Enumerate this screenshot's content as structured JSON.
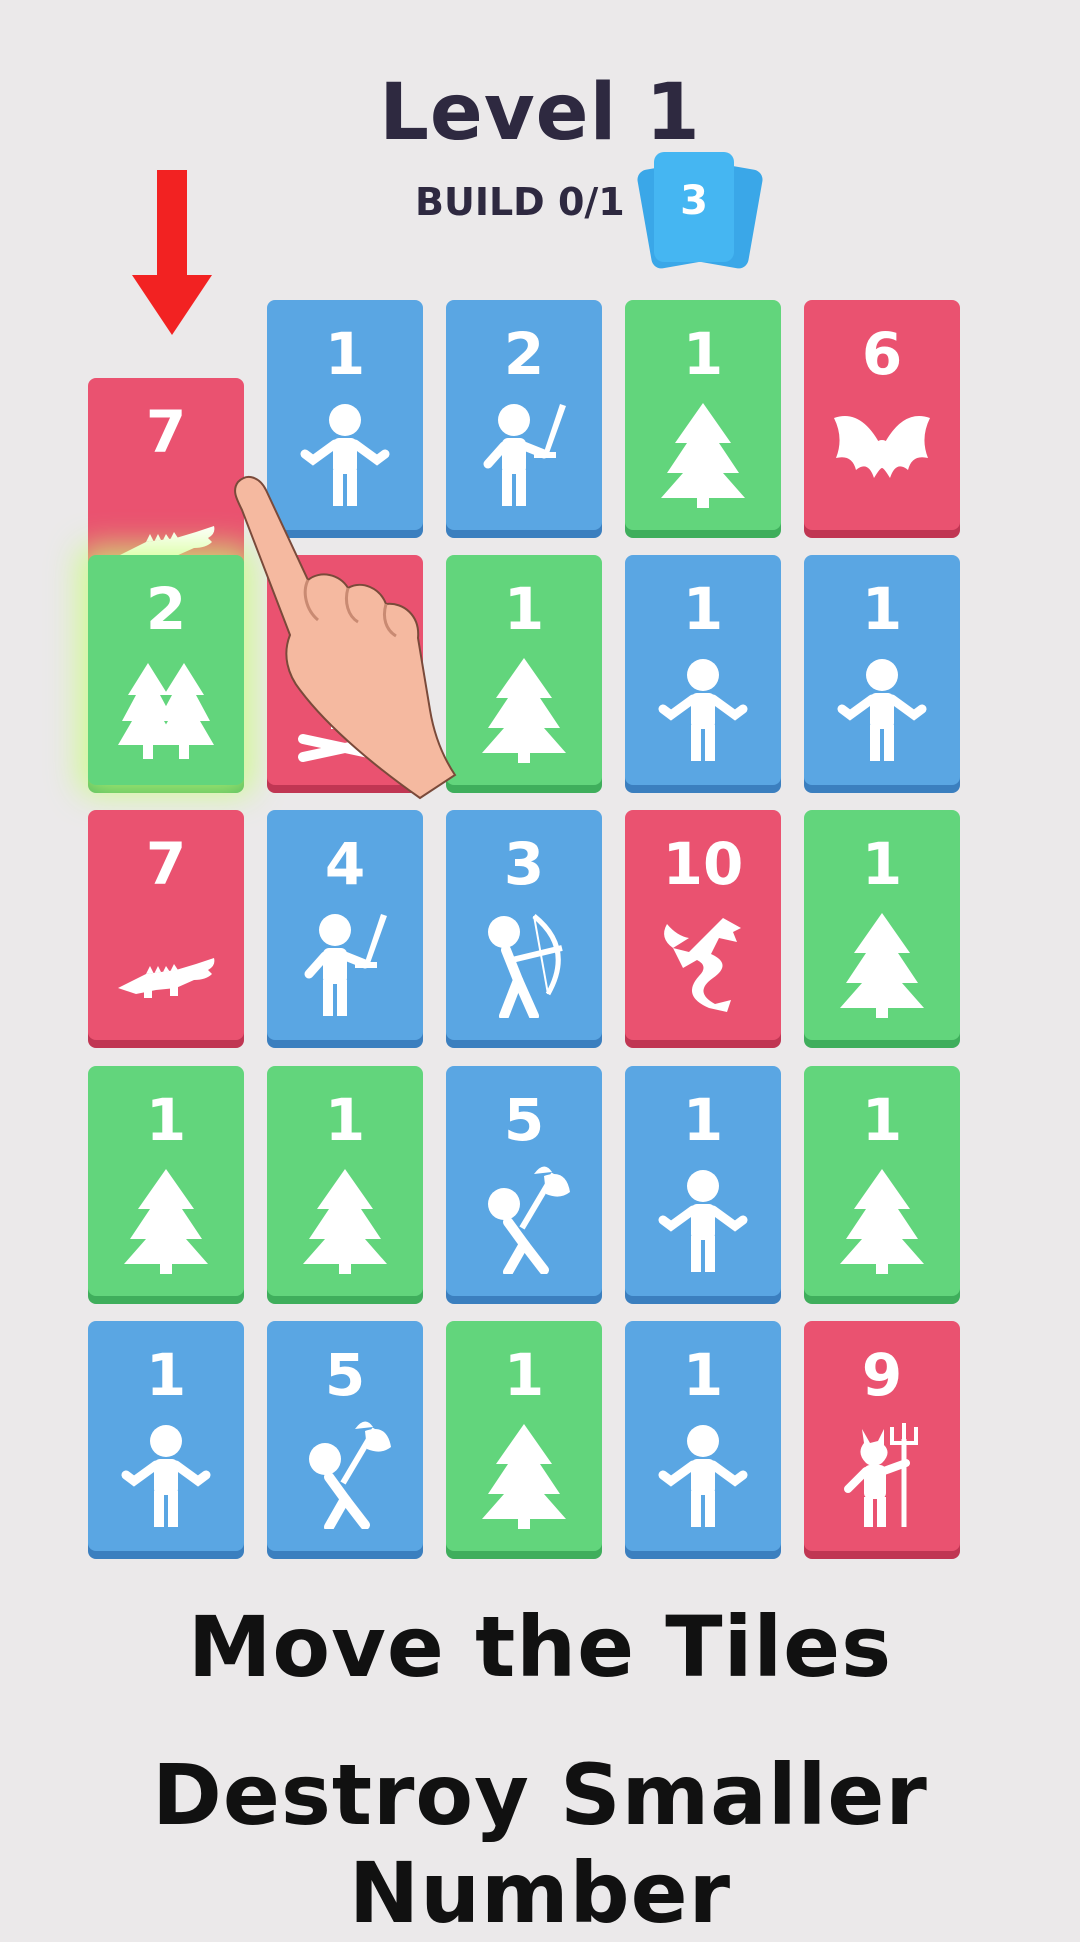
{
  "header": {
    "level_title": "Level 1",
    "build_progress": "BUILD 0/1",
    "deck_count": "3"
  },
  "board": {
    "rows": [
      [
        {
          "value": "7",
          "color": "red",
          "icon": "crocodile-icon"
        },
        {
          "value": "1",
          "color": "blue",
          "icon": "stickman-icon"
        },
        {
          "value": "2",
          "color": "blue",
          "icon": "swordsman-icon"
        },
        {
          "value": "1",
          "color": "green",
          "icon": "tree-icon"
        },
        {
          "value": "6",
          "color": "red",
          "icon": "bat-icon"
        }
      ],
      [
        {
          "value": "2",
          "color": "green",
          "icon": "two-trees-icon",
          "highlighted": true
        },
        {
          "value": "",
          "color": "red",
          "icon": "skull-icon"
        },
        {
          "value": "1",
          "color": "green",
          "icon": "tree-icon"
        },
        {
          "value": "1",
          "color": "blue",
          "icon": "stickman-icon"
        },
        {
          "value": "1",
          "color": "blue",
          "icon": "stickman-icon"
        }
      ],
      [
        {
          "value": "7",
          "color": "red",
          "icon": "crocodile-icon"
        },
        {
          "value": "4",
          "color": "blue",
          "icon": "swordsman-icon"
        },
        {
          "value": "3",
          "color": "blue",
          "icon": "archer-icon"
        },
        {
          "value": "10",
          "color": "red",
          "icon": "dragon-icon"
        },
        {
          "value": "1",
          "color": "green",
          "icon": "tree-icon"
        }
      ],
      [
        {
          "value": "1",
          "color": "green",
          "icon": "tree-icon"
        },
        {
          "value": "1",
          "color": "green",
          "icon": "tree-icon"
        },
        {
          "value": "5",
          "color": "blue",
          "icon": "axeman-icon"
        },
        {
          "value": "1",
          "color": "blue",
          "icon": "stickman-icon"
        },
        {
          "value": "1",
          "color": "green",
          "icon": "tree-icon"
        }
      ],
      [
        {
          "value": "1",
          "color": "blue",
          "icon": "stickman-icon"
        },
        {
          "value": "5",
          "color": "blue",
          "icon": "axeman-icon"
        },
        {
          "value": "1",
          "color": "green",
          "icon": "tree-icon"
        },
        {
          "value": "1",
          "color": "blue",
          "icon": "stickman-icon"
        },
        {
          "value": "9",
          "color": "red",
          "icon": "devil-icon"
        }
      ]
    ]
  },
  "overlay": {
    "arrow_icon": "down-arrow-icon",
    "hand_icon": "pointing-hand-icon"
  },
  "captions": {
    "line1": "Move the Tiles",
    "line2": "Destroy Smaller Number"
  }
}
